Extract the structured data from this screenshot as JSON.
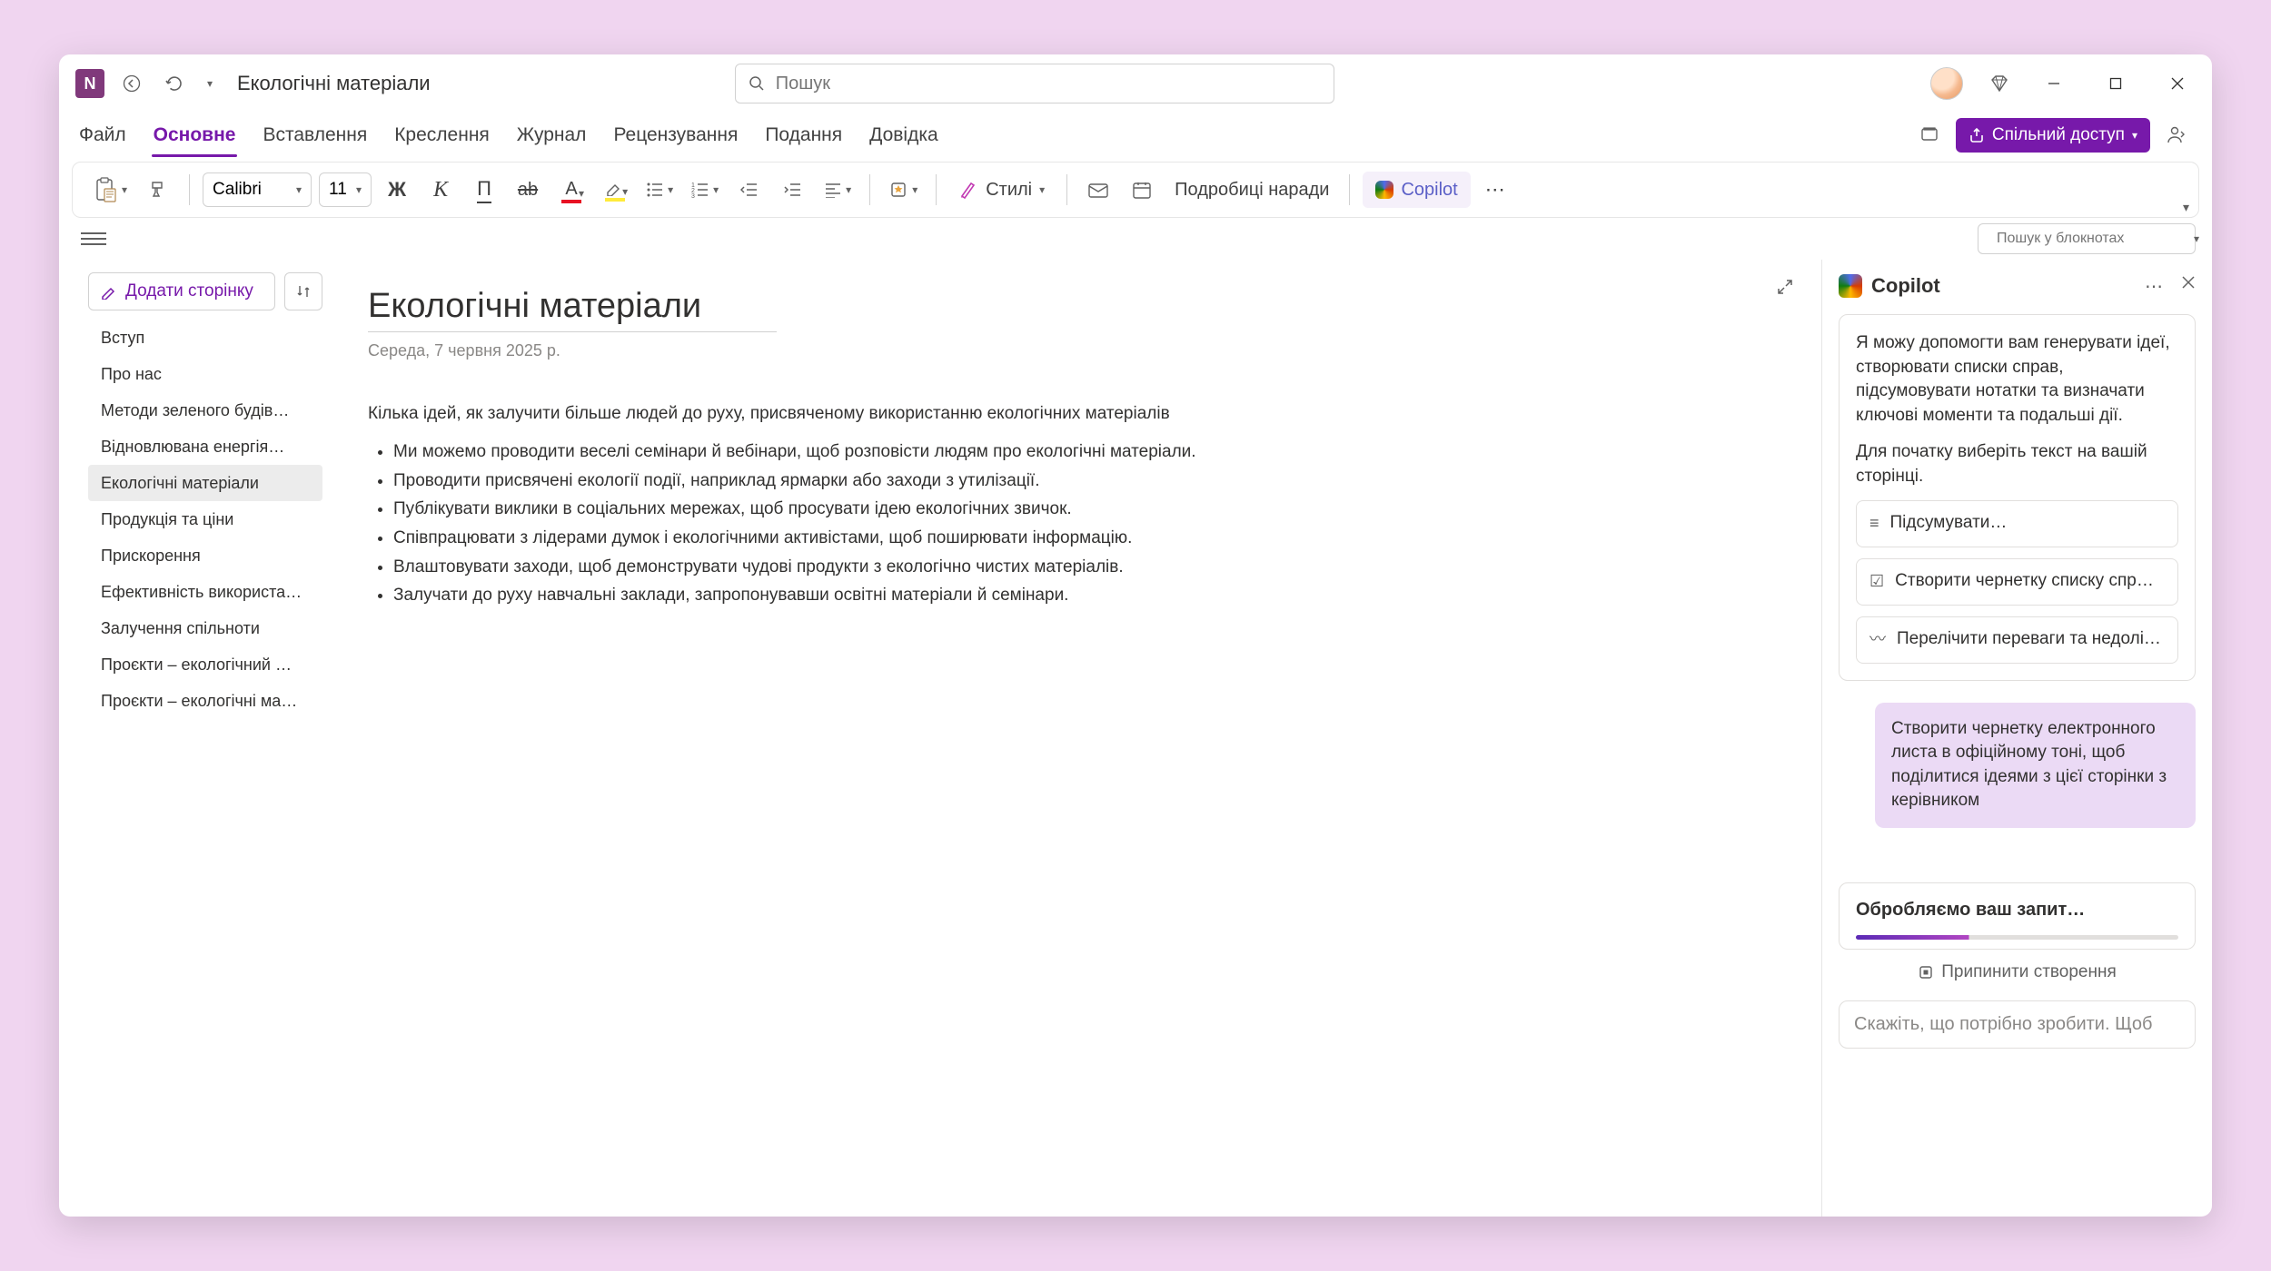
{
  "titlebar": {
    "doc_title": "Екологічні матеріали",
    "search_placeholder": "Пошук"
  },
  "tabs": [
    "Файл",
    "Основне",
    "Вставлення",
    "Креслення",
    "Журнал",
    "Рецензування",
    "Подання",
    "Довідка"
  ],
  "active_tab_index": 1,
  "share_label": "Спільний доступ",
  "ribbon": {
    "font": "Calibri",
    "size": "11",
    "bold": "Ж",
    "italic": "К",
    "underline": "П",
    "strike": "ab",
    "styles_label": "Стилі",
    "meeting_label": "Подробиці наради",
    "copilot_label": "Copilot"
  },
  "notebook_search_placeholder": "Пошук у блокнотах",
  "sidebar": {
    "add_page": "Додати сторінку",
    "pages": [
      "Вступ",
      "Про нас",
      "Методи зеленого будів…",
      "Відновлювана енергія…",
      "Екологічні матеріали",
      "Продукція та ціни",
      "Прискорення",
      "Ефективність використа…",
      "Залучення спільноти",
      "Проєкти – екологічний …",
      "Проєкти – екологічні ма…"
    ],
    "active_index": 4
  },
  "page": {
    "title": "Екологічні матеріали",
    "date": "Середа, 7 червня 2025 р.",
    "intro": "Кілька ідей, як залучити більше людей до руху, присвяченому використанню екологічних матеріалів",
    "bullets": [
      "Ми можемо проводити веселі семінари й вебінари, щоб розповісти людям про екологічні матеріали.",
      "Проводити присвячені екології події, наприклад ярмарки або заходи з утилізації.",
      "Публікувати виклики в соціальних мережах, щоб просувати ідею екологічних звичок.",
      "Співпрацювати з лідерами думок і екологічними активістами, щоб поширювати інформацію.",
      "Влаштовувати заходи, щоб демонструвати чудові продукти з екологічно чистих матеріалів.",
      "Залучати до руху навчальні заклади, запропонувавши освітні матеріали й семінари."
    ]
  },
  "copilot": {
    "title": "Copilot",
    "intro1": "Я можу допомогти вам генерувати ідеї, створювати списки справ, підсумовувати нотатки та визначати ключові моменти та подальші дії.",
    "intro2": "Для початку виберіть текст на вашій сторінці.",
    "suggestions": [
      "Підсумувати…",
      "Створити чернетку списку спр…",
      "Перелічити переваги та недолі…"
    ],
    "user_message": "Створити чернетку електронного листа в офіційному тоні, щоб поділитися ідеями з цієї сторінки з керівником",
    "processing": "Обробляємо ваш запит…",
    "stop_label": "Припинити створення",
    "input_placeholder": "Скажіть, що потрібно зробити. Щоб"
  }
}
